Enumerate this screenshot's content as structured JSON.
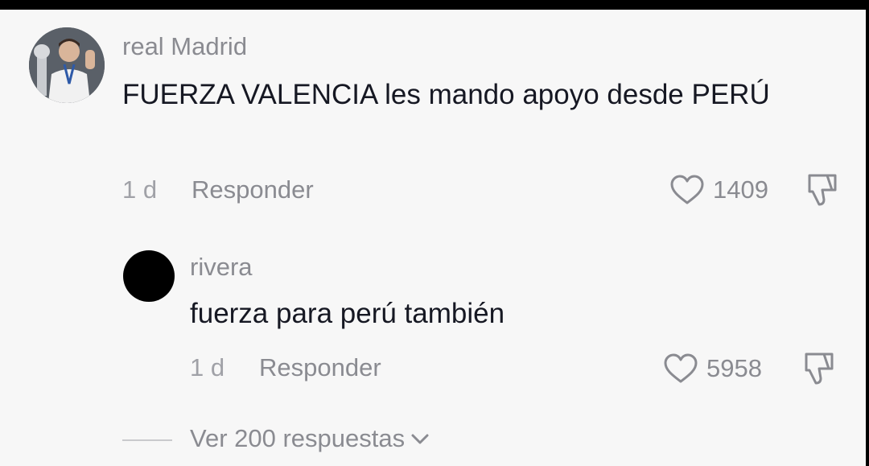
{
  "comment": {
    "username": "real Madrid",
    "text": "FUERZA VALENCIA les mando apoyo desde PERÚ",
    "time": "1 d",
    "reply_label": "Responder",
    "likes": "1409"
  },
  "reply": {
    "username": "rivera",
    "text": "fuerza para perú también",
    "time": "1 d",
    "reply_label": "Responder",
    "likes": "5958"
  },
  "view_replies_label": "Ver 200 respuestas",
  "icons": {
    "like": "heart-outline-icon",
    "dislike": "thumbs-down-outline-icon",
    "expand": "chevron-down-icon"
  }
}
